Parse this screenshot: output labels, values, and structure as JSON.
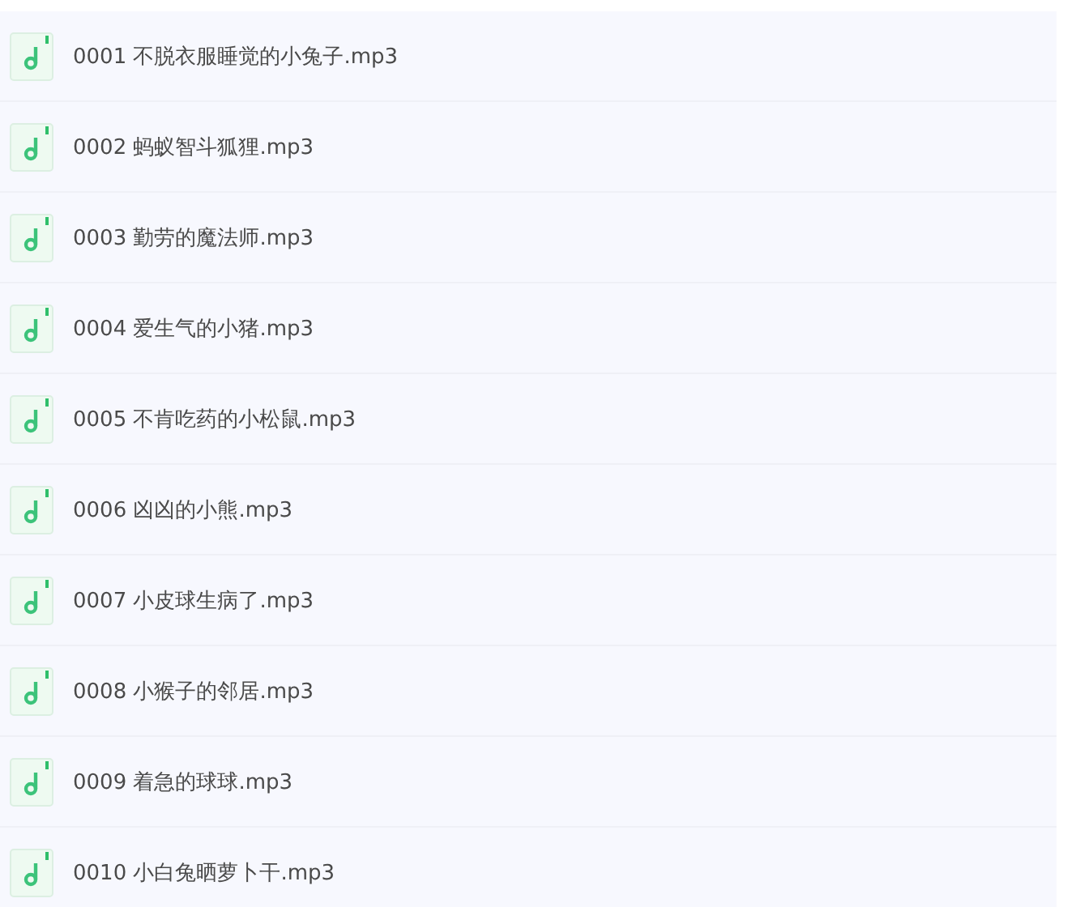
{
  "files": [
    {
      "name": "0001 不脱衣服睡觉的小兔子.mp3"
    },
    {
      "name": "0002 蚂蚁智斗狐狸.mp3"
    },
    {
      "name": "0003 勤劳的魔法师.mp3"
    },
    {
      "name": "0004 爱生气的小猪.mp3"
    },
    {
      "name": "0005 不肯吃药的小松鼠.mp3"
    },
    {
      "name": "0006 凶凶的小熊.mp3"
    },
    {
      "name": "0007 小皮球生病了.mp3"
    },
    {
      "name": "0008 小猴子的邻居.mp3"
    },
    {
      "name": "0009 着急的球球.mp3"
    },
    {
      "name": "0010 小白兔晒萝卜干.mp3"
    }
  ]
}
